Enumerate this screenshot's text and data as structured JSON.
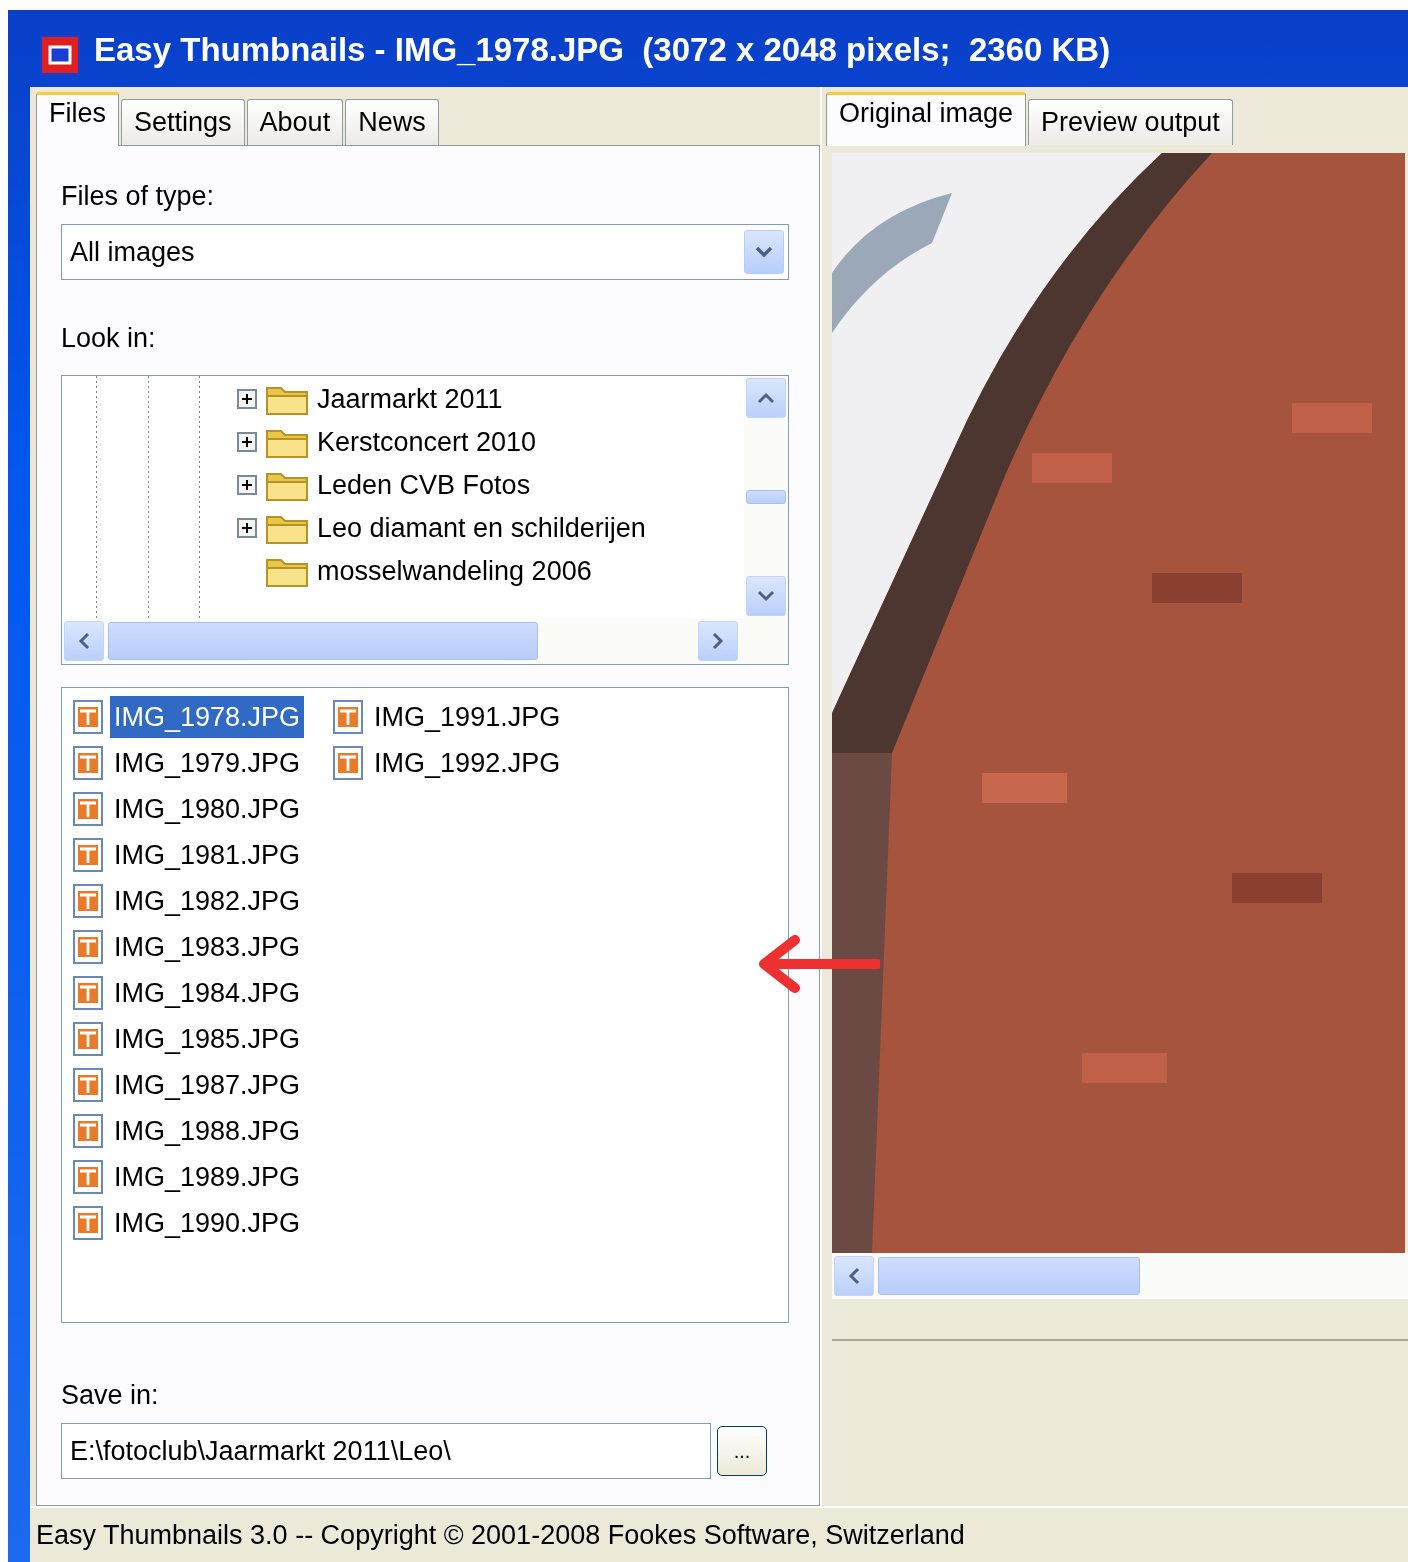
{
  "window": {
    "title": "Easy Thumbnails - IMG_1978.JPG  (3072 x 2048 pixels;  2360 KB)"
  },
  "left_tabs": [
    {
      "label": "Files",
      "selected": true
    },
    {
      "label": "Settings",
      "selected": false
    },
    {
      "label": "About",
      "selected": false
    },
    {
      "label": "News",
      "selected": false
    }
  ],
  "files_of_type": {
    "label": "Files of type:",
    "value": "All images"
  },
  "look_in": {
    "label": "Look in:"
  },
  "folder_tree": [
    {
      "name": "Jaarmarkt 2011",
      "expandable": true
    },
    {
      "name": "Kerstconcert 2010",
      "expandable": true
    },
    {
      "name": "Leden CVB Fotos",
      "expandable": true
    },
    {
      "name": "Leo diamant en schilderijen",
      "expandable": true
    },
    {
      "name": "mosselwandeling 2006",
      "expandable": false
    }
  ],
  "files": [
    {
      "name": "IMG_1978.JPG",
      "selected": true
    },
    {
      "name": "IMG_1979.JPG",
      "selected": false
    },
    {
      "name": "IMG_1980.JPG",
      "selected": false
    },
    {
      "name": "IMG_1981.JPG",
      "selected": false
    },
    {
      "name": "IMG_1982.JPG",
      "selected": false
    },
    {
      "name": "IMG_1983.JPG",
      "selected": false
    },
    {
      "name": "IMG_1984.JPG",
      "selected": false
    },
    {
      "name": "IMG_1985.JPG",
      "selected": false
    },
    {
      "name": "IMG_1987.JPG",
      "selected": false
    },
    {
      "name": "IMG_1988.JPG",
      "selected": false
    },
    {
      "name": "IMG_1989.JPG",
      "selected": false
    },
    {
      "name": "IMG_1990.JPG",
      "selected": false
    },
    {
      "name": "IMG_1991.JPG",
      "selected": false
    },
    {
      "name": "IMG_1992.JPG",
      "selected": false
    }
  ],
  "save_in": {
    "label": "Save in:",
    "value": "E:\\fotoclub\\Jaarmarkt 2011\\Leo\\",
    "browse_button": "..."
  },
  "right_tabs": [
    {
      "label": "Original image",
      "selected": true
    },
    {
      "label": "Preview output",
      "selected": false
    }
  ],
  "status_bar": "Easy Thumbnails 3.0 -- Copyright © 2001-2008 Fookes Software, Switzerland"
}
